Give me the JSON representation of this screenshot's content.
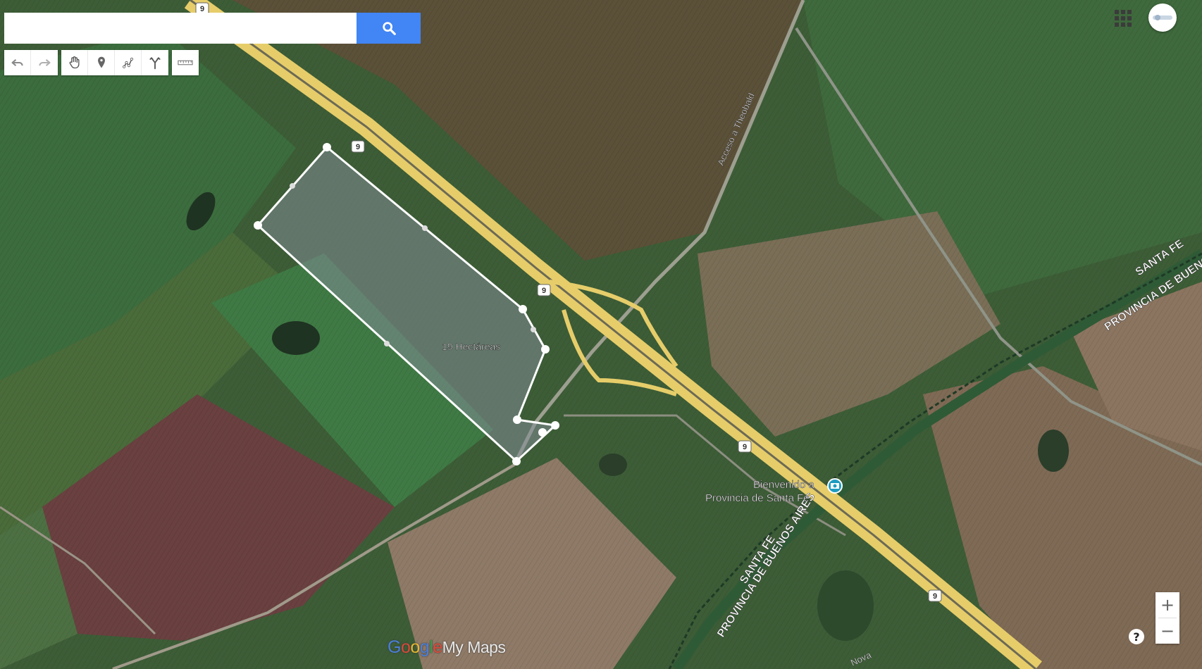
{
  "search": {
    "placeholder": "",
    "value": ""
  },
  "toolbar": {
    "undo_icon": "undo-icon",
    "redo_icon": "redo-icon",
    "hand_icon": "hand-icon",
    "marker_icon": "marker-icon",
    "draw_line_icon": "draw-line-icon",
    "directions_icon": "directions-icon",
    "ruler_icon": "ruler-icon"
  },
  "map": {
    "area_label": "19 Hectáreas",
    "road_label_theobald": "Acceso a Theobald",
    "border_label_santa_fe_1": "SANTA FE",
    "border_label_buenos_aires_1": "PROVINCIA DE BUENOS",
    "border_label_santa_fe_2": "SANTA FE",
    "border_label_buenos_aires_2": "PROVINCIA DE BUENOS AIRES",
    "welcome_line1": "Bienvenido a",
    "welcome_line2": "Provincia de Santa Fe",
    "street_fragment": "Nova",
    "route_shield": "9"
  },
  "zoom": {
    "in": "+",
    "out": "−"
  },
  "help": "?",
  "logo": {
    "g1": "G",
    "g2": "o",
    "g3": "o",
    "g4": "g",
    "g5": "l",
    "g6": "e",
    "rest": "My Maps"
  },
  "colors": {
    "accent": "#4285f4",
    "highway": "#e6cd6a",
    "polygon_stroke": "#ffffff"
  }
}
